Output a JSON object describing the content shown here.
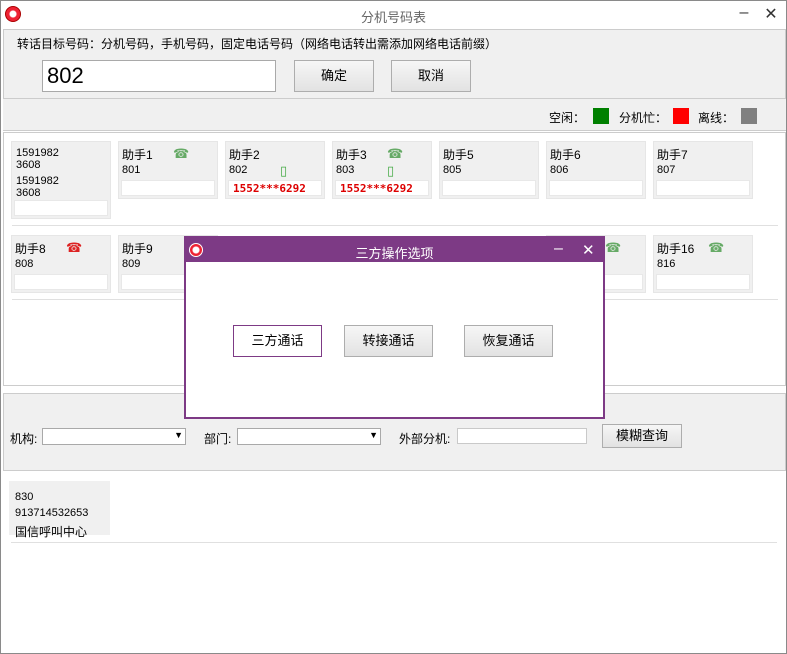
{
  "window": {
    "title": "分机号码表",
    "min": "–",
    "close": "✕"
  },
  "top": {
    "hint": "转话目标号码：分机号码，手机号码，固定电话号码（网络电话转出需添加网络电话前缀）",
    "input_value": "802",
    "ok_label": "确定",
    "cancel_label": "取消"
  },
  "legend": {
    "idle_label": "空闲：",
    "busy_label": "分机忙：",
    "offline_label": "离线：",
    "colors": {
      "idle": "#008000",
      "busy": "#ff0000",
      "offline": "#808080"
    }
  },
  "cards": {
    "c0": {
      "l1": "1591982",
      "l2": "3608",
      "l3": "1591982",
      "l4": "3608"
    },
    "c1": {
      "name": "助手1",
      "num": "801",
      "icon": "phone-idle-icon"
    },
    "c2": {
      "name": "助手2",
      "num": "802",
      "call": "1552***6292",
      "icon": "mobile-icon"
    },
    "c3": {
      "name": "助手3",
      "num": "803",
      "call": "1552***6292",
      "icon": "phone-idle-icon"
    },
    "c5": {
      "name": "助手5",
      "num": "805"
    },
    "c6": {
      "name": "助手6",
      "num": "806"
    },
    "c7": {
      "name": "助手7",
      "num": "807"
    },
    "c8": {
      "name": "助手8",
      "num": "808",
      "icon": "phone-busy-icon"
    },
    "c9": {
      "name": "助手9",
      "num": "809"
    },
    "c16": {
      "name": "助手16",
      "num": "816",
      "icon": "phone-idle-icon"
    }
  },
  "search": {
    "org_label": "机构:",
    "dept_label": "部门:",
    "ext_label": "外部分机:",
    "fuzzy_label": "模糊查询"
  },
  "result": {
    "num": "830",
    "phone": "913714532653",
    "name": "国信呼叫中心"
  },
  "dialog": {
    "title": "三方操作选项",
    "min": "–",
    "close": "✕",
    "three_label": "三方通话",
    "transfer_label": "转接通话",
    "resume_label": "恢复通话"
  }
}
